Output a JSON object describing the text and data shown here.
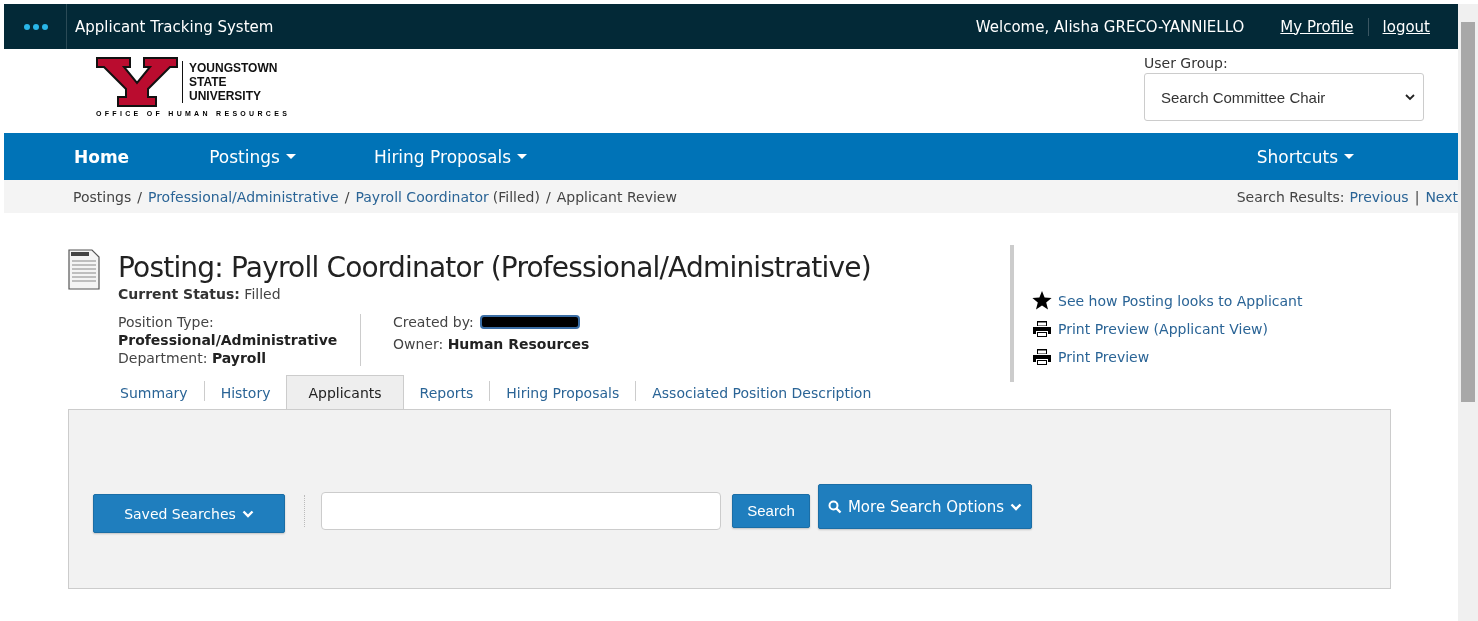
{
  "topbar": {
    "title": "Applicant Tracking System",
    "welcome": "Welcome, Alisha GRECO-YANNIELLO",
    "links": [
      "My Profile",
      "logout"
    ]
  },
  "logo": {
    "lines": [
      "YOUNGSTOWN",
      "STATE",
      "UNIVERSITY"
    ],
    "tagline": "OFFICE OF HUMAN RESOURCES"
  },
  "user_group": {
    "label": "User Group:",
    "value": "Search Committee Chair"
  },
  "nav": {
    "items": [
      {
        "label": "Home",
        "dropdown": false,
        "selected": true
      },
      {
        "label": "Postings",
        "dropdown": true,
        "selected": false
      },
      {
        "label": "Hiring Proposals",
        "dropdown": true,
        "selected": false
      }
    ],
    "shortcuts": "Shortcuts"
  },
  "breadcrumb": [
    {
      "text": "Postings",
      "link": false
    },
    {
      "separator": "/",
      "text": "Professional/Administrative",
      "link": true
    },
    {
      "separator": "/",
      "text": "Payroll Coordinator",
      "link": true,
      "suffix": "(Filled)"
    },
    {
      "separator": "/",
      "text": "Applicant Review",
      "link": false
    }
  ],
  "search_results": {
    "label": "Search Results:",
    "previous": "Previous",
    "divider": "|",
    "next": "Next"
  },
  "posting": {
    "title": "Posting: Payroll Coordinator (Professional/Administrative)",
    "status_label": "Current Status:",
    "status": "Filled",
    "position_type_label": "Position Type:",
    "position_type": "Professional/Administrative",
    "department_label": "Department:",
    "department": "Payroll",
    "created_by_label": "Created by:",
    "owner_label": "Owner:",
    "owner": "Human Resources"
  },
  "actions": [
    {
      "kind": "star",
      "label": "See how Posting looks to Applicant"
    },
    {
      "kind": "print",
      "label": "Print Preview (Applicant View)"
    },
    {
      "kind": "print",
      "label": "Print Preview"
    }
  ],
  "tabs": [
    {
      "label": "Summary",
      "selected": false
    },
    {
      "label": "History",
      "selected": false
    },
    {
      "label": "Applicants",
      "selected": true
    },
    {
      "label": "Reports",
      "selected": false
    },
    {
      "label": "Hiring Proposals",
      "selected": false
    },
    {
      "label": "Associated Position Description",
      "selected": false
    }
  ],
  "search_bar": {
    "saved_searches": "Saved Searches",
    "search_button": "Search",
    "more_options": "More Search Options"
  }
}
